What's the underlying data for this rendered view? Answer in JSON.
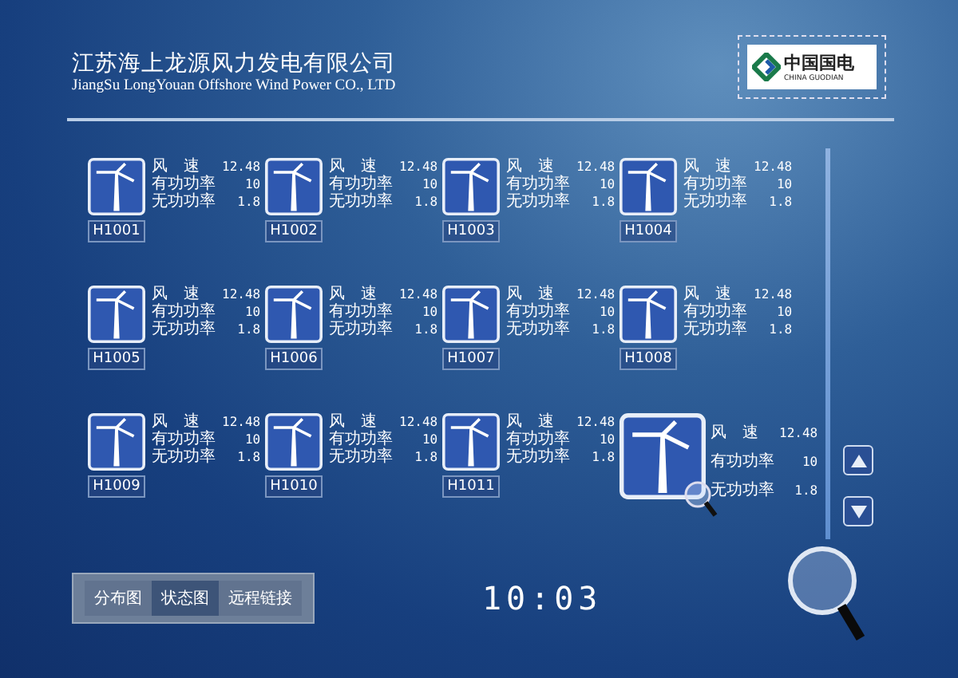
{
  "header": {
    "title": "江苏海上龙源风力发电有限公司",
    "subtitle": "JiangSu LongYouan Offshore Wind Power CO., LTD",
    "logo": {
      "name": "中国国电",
      "subtitle": "CHINA GUODIAN"
    }
  },
  "turbines": [
    {
      "name": "H1001",
      "selected": false,
      "readings": [
        {
          "label": "风　速",
          "value": "12.48"
        },
        {
          "label": "有功功率",
          "value": "10"
        },
        {
          "label": "无功功率",
          "value": "1.8"
        }
      ]
    },
    {
      "name": "H1002",
      "selected": false,
      "readings": [
        {
          "label": "风　速",
          "value": "12.48"
        },
        {
          "label": "有功功率",
          "value": "10"
        },
        {
          "label": "无功功率",
          "value": "1.8"
        }
      ]
    },
    {
      "name": "H1003",
      "selected": false,
      "readings": [
        {
          "label": "风　速",
          "value": "12.48"
        },
        {
          "label": "有功功率",
          "value": "10"
        },
        {
          "label": "无功功率",
          "value": "1.8"
        }
      ]
    },
    {
      "name": "H1004",
      "selected": false,
      "readings": [
        {
          "label": "风　速",
          "value": "12.48"
        },
        {
          "label": "有功功率",
          "value": "10"
        },
        {
          "label": "无功功率",
          "value": "1.8"
        }
      ]
    },
    {
      "name": "H1005",
      "selected": false,
      "readings": [
        {
          "label": "风　速",
          "value": "12.48"
        },
        {
          "label": "有功功率",
          "value": "10"
        },
        {
          "label": "无功功率",
          "value": "1.8"
        }
      ]
    },
    {
      "name": "H1006",
      "selected": false,
      "readings": [
        {
          "label": "风　速",
          "value": "12.48"
        },
        {
          "label": "有功功率",
          "value": "10"
        },
        {
          "label": "无功功率",
          "value": "1.8"
        }
      ]
    },
    {
      "name": "H1007",
      "selected": false,
      "readings": [
        {
          "label": "风　速",
          "value": "12.48"
        },
        {
          "label": "有功功率",
          "value": "10"
        },
        {
          "label": "无功功率",
          "value": "1.8"
        }
      ]
    },
    {
      "name": "H1008",
      "selected": false,
      "readings": [
        {
          "label": "风　速",
          "value": "12.48"
        },
        {
          "label": "有功功率",
          "value": "10"
        },
        {
          "label": "无功功率",
          "value": "1.8"
        }
      ]
    },
    {
      "name": "H1009",
      "selected": false,
      "readings": [
        {
          "label": "风　速",
          "value": "12.48"
        },
        {
          "label": "有功功率",
          "value": "10"
        },
        {
          "label": "无功功率",
          "value": "1.8"
        }
      ]
    },
    {
      "name": "H1010",
      "selected": false,
      "readings": [
        {
          "label": "风　速",
          "value": "12.48"
        },
        {
          "label": "有功功率",
          "value": "10"
        },
        {
          "label": "无功功率",
          "value": "1.8"
        }
      ]
    },
    {
      "name": "H1011",
      "selected": false,
      "readings": [
        {
          "label": "风　速",
          "value": "12.48"
        },
        {
          "label": "有功功率",
          "value": "10"
        },
        {
          "label": "无功功率",
          "value": "1.8"
        }
      ]
    },
    {
      "selected": true,
      "readings": [
        {
          "label": "风　速",
          "value": "12.48"
        },
        {
          "label": "有功功率",
          "value": "10"
        },
        {
          "label": "无功功率",
          "value": "1.8"
        }
      ]
    }
  ],
  "tabs": [
    {
      "label": "分布图",
      "selected": false
    },
    {
      "label": "状态图",
      "selected": true
    },
    {
      "label": "远程链接",
      "selected": false
    }
  ],
  "clock": "10:03"
}
